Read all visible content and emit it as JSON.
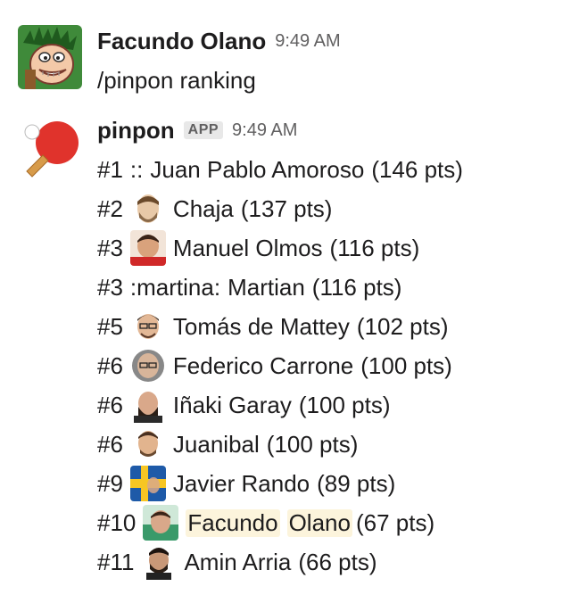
{
  "message1": {
    "author": "Facundo Olano",
    "time": "9:49 AM",
    "text": "/pinpon ranking",
    "avatar_icon": "cartoon-face-avatar"
  },
  "message2": {
    "author": "pinpon",
    "badge": "APP",
    "time": "9:49 AM",
    "avatar_icon": "ping-pong-paddle-icon",
    "ranking": [
      {
        "rank": "#1",
        "prefix": "::",
        "name": "Juan Pablo Amoroso",
        "points": "(146 pts)",
        "emoji": null
      },
      {
        "rank": "#2",
        "name": "Chaja",
        "points": "(137 pts)",
        "emoji": "chaja-avatar"
      },
      {
        "rank": "#3",
        "name": "Manuel Olmos",
        "points": "(116 pts)",
        "emoji": "manuel-avatar"
      },
      {
        "rank": "#3",
        "prefix": ":martina:",
        "name": "Martian",
        "points": "(116 pts)",
        "emoji": null
      },
      {
        "rank": "#5",
        "name": "Tomás de Mattey",
        "points": "(102 pts)",
        "emoji": "tomas-avatar"
      },
      {
        "rank": "#6",
        "name": "Federico Carrone",
        "points": "(100 pts)",
        "emoji": "federico-avatar"
      },
      {
        "rank": "#6",
        "name": "Iñaki Garay",
        "points": "(100 pts)",
        "emoji": "inaki-avatar"
      },
      {
        "rank": "#6",
        "name": "Juanibal",
        "points": "(100 pts)",
        "emoji": "juanibal-avatar"
      },
      {
        "rank": "#9",
        "name": "Javier Rando",
        "points": "(89 pts)",
        "emoji": "javier-flag-avatar"
      },
      {
        "rank": "#10",
        "name_first": "Facundo",
        "name_last": "Olano",
        "points": "(67 pts)",
        "emoji": "facundo-avatar"
      },
      {
        "rank": "#11",
        "name": "Amin Arria",
        "points": "(66 pts)",
        "emoji": "amin-avatar"
      }
    ]
  }
}
